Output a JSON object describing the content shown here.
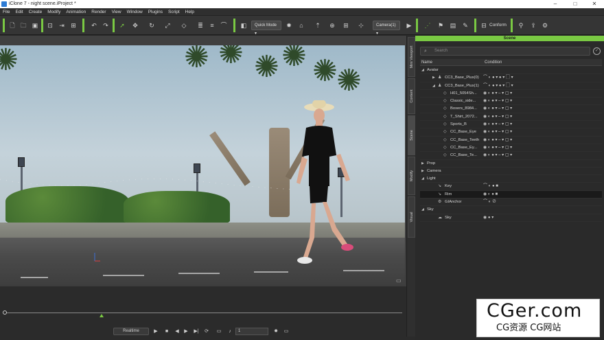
{
  "window": {
    "title": "iClone 7 - night scene.iProject *",
    "controls": [
      "–",
      "□",
      "✕"
    ]
  },
  "menu": [
    "File",
    "Edit",
    "Create",
    "Modify",
    "Animation",
    "Render",
    "View",
    "Window",
    "Plugins",
    "Script",
    "Help"
  ],
  "toolbar": {
    "quick_mode": "Quick Mode",
    "camera": "Camera(1)",
    "conform": "Conform"
  },
  "side_tabs": [
    "Mini Viewport",
    "Content",
    "Scene",
    "Modify",
    "Visual"
  ],
  "scene_panel": {
    "header": "Scene",
    "search_placeholder": "Search",
    "col_name": "Name",
    "col_condition": "Condition",
    "rows": [
      {
        "label": "Avatar",
        "level": 0,
        "arrow": "◢",
        "icon": "",
        "cond": ""
      },
      {
        "label": "CC3_Base_Plus(0)",
        "level": 2,
        "arrow": "▶",
        "icon": "person-icon",
        "cond": "⌒ ◐ ● ▾ ● ▾ ▢ ▾"
      },
      {
        "label": "CC3_Base_Plus(1)",
        "level": 2,
        "arrow": "◢",
        "icon": "person-icon",
        "cond": "⌒ ◐ ● ▾ ● ▾ ▢ ▾"
      },
      {
        "label": "H01_5054Sh...",
        "level": 3,
        "arrow": "",
        "icon": "mesh-icon",
        "cond": "◉ ◐ ● ▾ – ▾ ▢ ▾"
      },
      {
        "label": "Classic_side...",
        "level": 3,
        "arrow": "",
        "icon": "mesh-icon",
        "cond": "◉ ◐ ● ▾ – ▾ ▢ ▾"
      },
      {
        "label": "Boxers_8984...",
        "level": 3,
        "arrow": "",
        "icon": "mesh-icon",
        "cond": "◉ ◐ ● ▾ – ▾ ▢ ▾"
      },
      {
        "label": "T_Shirt_2072...",
        "level": 3,
        "arrow": "",
        "icon": "mesh-icon",
        "cond": "◉ ◐ ● ▾ – ▾ ▢ ▾"
      },
      {
        "label": "Sports_B",
        "level": 3,
        "arrow": "",
        "icon": "mesh-icon",
        "cond": "◉ ◐ ● ▾ – ▾ ▢ ▾"
      },
      {
        "label": "CC_Base_Eye",
        "level": 3,
        "arrow": "",
        "icon": "mesh-icon",
        "cond": "◉ ◐ ● ▾ – ▾ ▢ ▾"
      },
      {
        "label": "CC_Base_Teeth",
        "level": 3,
        "arrow": "",
        "icon": "mesh-icon",
        "cond": "◉ ◐ ● ▾ – ▾ ▢ ▾"
      },
      {
        "label": "CC_Base_Ey...",
        "level": 3,
        "arrow": "",
        "icon": "mesh-icon",
        "cond": "◉ ◐ ● ▾ – ▾ ▢ ▾"
      },
      {
        "label": "CC_Base_Te...",
        "level": 3,
        "arrow": "",
        "icon": "mesh-icon",
        "cond": "◉ ◐ ● ▾ – ▾ ▢ ▾"
      },
      {
        "label": "Prop",
        "level": 0,
        "arrow": "▶",
        "icon": "",
        "cond": ""
      },
      {
        "label": "Camera",
        "level": 0,
        "arrow": "▶",
        "icon": "",
        "cond": ""
      },
      {
        "label": "Light",
        "level": 0,
        "arrow": "◢",
        "icon": "",
        "cond": ""
      },
      {
        "label": "Key",
        "level": 2,
        "arrow": "",
        "icon": "light-icon",
        "cond": "⌒ ◐ ● ■"
      },
      {
        "label": "Rim",
        "level": 2,
        "arrow": "",
        "icon": "light-icon",
        "cond": "◉ ◐ ● ■",
        "selected": true
      },
      {
        "label": "GIAnchor",
        "level": 2,
        "arrow": "",
        "icon": "anchor-icon",
        "cond": "⌒ ◐ ⊘"
      },
      {
        "label": "Sky",
        "level": 0,
        "arrow": "◢",
        "icon": "",
        "cond": ""
      },
      {
        "label": "Sky",
        "level": 2,
        "arrow": "",
        "icon": "sky-icon",
        "cond": "◉ ● ▾"
      }
    ]
  },
  "playback": {
    "mode": "Realtime",
    "frame": "1"
  },
  "watermark": {
    "line1": "CGer.com",
    "line2": "CG资源 CG网站"
  },
  "colors": {
    "accent": "#7ac943",
    "panel_bg": "#2a2a2a",
    "toolbar_bg": "#353535"
  }
}
